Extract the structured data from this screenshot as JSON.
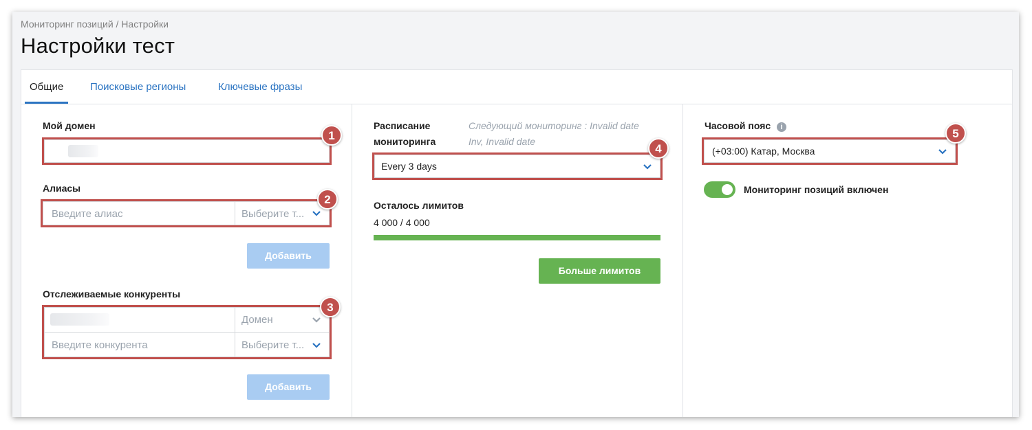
{
  "header": {
    "breadcrumb": "Мониторинг позиций / Настройки",
    "title": "Настройки тест"
  },
  "tabs": [
    {
      "label": "Общие",
      "active": true
    },
    {
      "label": "Поисковые регионы",
      "active": false
    },
    {
      "label": "Ключевые фразы",
      "active": false
    }
  ],
  "left": {
    "domain_label": "Мой домен",
    "aliases_label": "Алиасы",
    "alias_placeholder": "Введите алиас",
    "alias_type_placeholder": "Выберите т...",
    "add_label": "Добавить",
    "competitors_label": "Отслеживаемые конкуренты",
    "competitor_type_value": "Домен",
    "competitor_placeholder": "Введите конкурента",
    "competitor_type_placeholder": "Выберите т...",
    "add_label_2": "Добавить"
  },
  "middle": {
    "schedule_label_1": "Расписание",
    "schedule_label_2": "мониторинга",
    "next_monitoring_1": "Следующий мониторинг : Invalid date",
    "next_monitoring_2": "Inv, Invalid date",
    "schedule_value": "Every 3 days",
    "limits_label": "Осталось лимитов",
    "limits_value": "4 000 / 4 000",
    "limits_fraction": 1.0,
    "more_limits_label": "Больше лимитов"
  },
  "right": {
    "timezone_label": "Часовой пояс",
    "timezone_value": "(+03:00) Катар, Москва",
    "toggle_label": "Мониторинг позиций включен",
    "toggle_on": true
  },
  "callouts": [
    "1",
    "2",
    "3",
    "4",
    "5"
  ],
  "colors": {
    "accent": "#2b74c2",
    "callout": "#c0504d",
    "green": "#66b352",
    "add_button_disabled": "#a9ccf2"
  }
}
